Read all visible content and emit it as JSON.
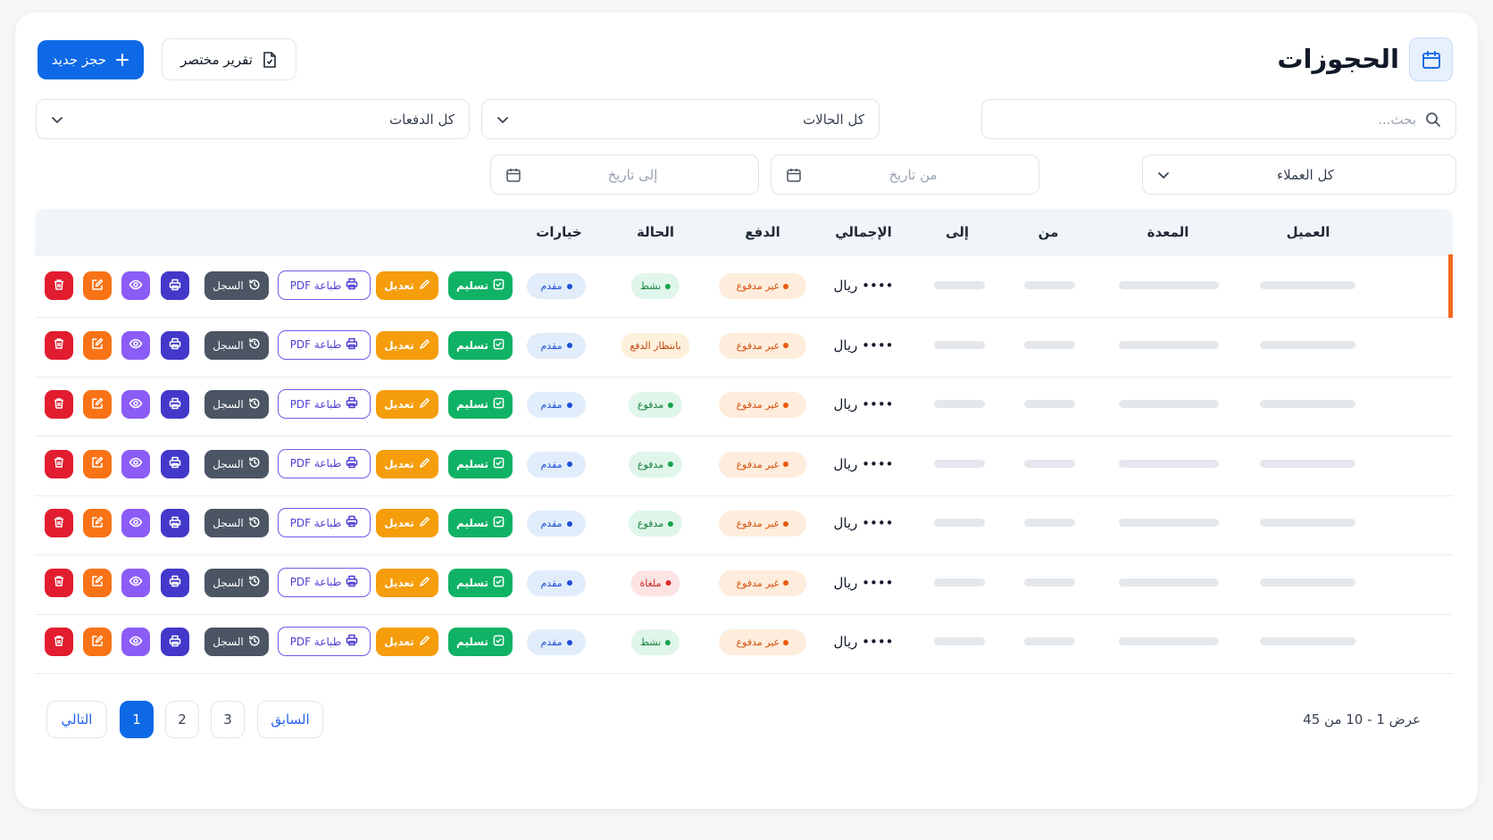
{
  "header": {
    "title": "الحجوزات",
    "new_booking_label": "حجز جديد",
    "report_label": "تقرير مختصر"
  },
  "filters": {
    "search_placeholder": "بحث...",
    "status_select": "كل الحالات",
    "payments_select": "كل الدفعات",
    "customers_select": "كل العملاء",
    "from_date_placeholder": "من تاريخ",
    "to_date_placeholder": "إلى تاريخ"
  },
  "table": {
    "columns": {
      "customer": "العميل",
      "equipment": "المعدة",
      "from": "من",
      "to": "إلى",
      "total": "الإجمالي",
      "payment": "الدفع",
      "status": "الحالة",
      "options": "خيارات"
    },
    "rows": [
      {
        "total": "•••• ريال",
        "payment": "غير مدفوع",
        "status": "نشط",
        "status_kind": "active",
        "option": "مقدم"
      },
      {
        "total": "•••• ريال",
        "payment": "غير مدفوع",
        "status": "بانتظار الدفع",
        "status_kind": "pending",
        "option": "مقدم"
      },
      {
        "total": "•••• ريال",
        "payment": "غير مدفوع",
        "status": "مدفوع",
        "status_kind": "paid",
        "option": "مقدم"
      },
      {
        "total": "•••• ريال",
        "payment": "غير مدفوع",
        "status": "مدفوع",
        "status_kind": "paid",
        "option": "مقدم"
      },
      {
        "total": "•••• ريال",
        "payment": "غير مدفوع",
        "status": "مدفوع",
        "status_kind": "paid",
        "option": "مقدم"
      },
      {
        "total": "•••• ريال",
        "payment": "غير مدفوع",
        "status": "ملغاة",
        "status_kind": "void",
        "option": "مقدم"
      },
      {
        "total": "•••• ريال",
        "payment": "غير مدفوع",
        "status": "نشط",
        "status_kind": "active",
        "option": "مقدم"
      }
    ],
    "actions": {
      "deliver": "تسليم",
      "edit": "تعديل",
      "print_pdf": "طباعة PDF",
      "log": "السجل"
    }
  },
  "pagination": {
    "summary": "عرض 1 - 10 من 45",
    "prev": "السابق",
    "next": "التالي",
    "pages": [
      "3",
      "2",
      "1"
    ],
    "current": "1"
  },
  "colors": {
    "primary": "#0e69e6",
    "selected_row_marker": "#f26b1d",
    "deliver": "#10b265",
    "edit": "#f59d0b",
    "log": "#4b5563",
    "print": "#4338ca",
    "view": "#8b5cf6",
    "edit_icon": "#f97316",
    "delete": "#e11d2f"
  }
}
